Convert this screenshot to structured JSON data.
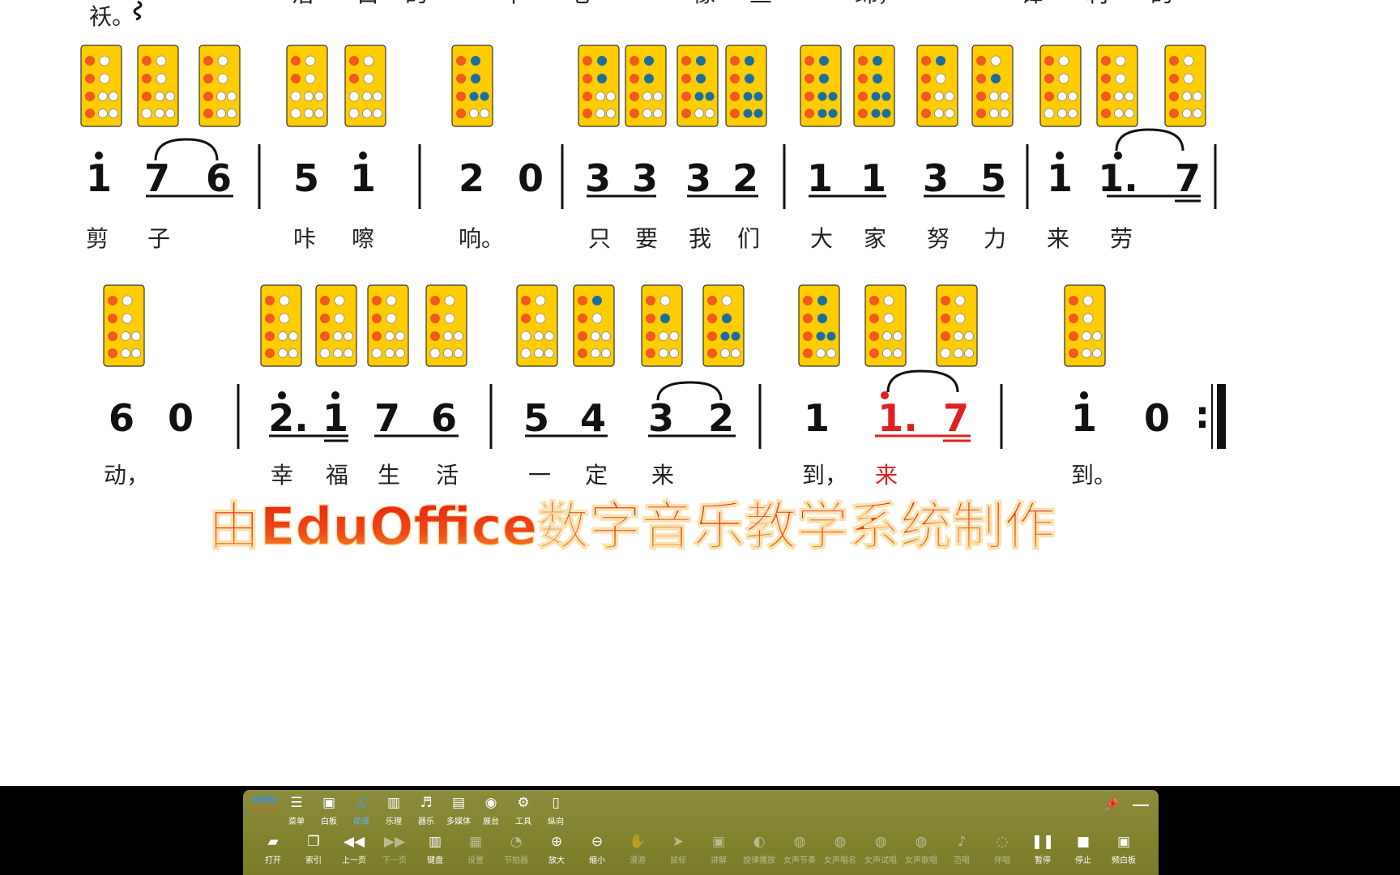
{
  "score": {
    "lyrics": {
      "line0": [
        "袄。",
        "洁",
        "白",
        "的",
        "羊",
        "毛",
        "像",
        "丝",
        "绵，",
        "锋",
        "利",
        "的"
      ],
      "line1": [
        "剪",
        "子",
        "咔",
        "嚓",
        "响。",
        "只",
        "要",
        "我",
        "们",
        "大",
        "家",
        "努",
        "力",
        "来",
        "劳"
      ],
      "line2": [
        "动，",
        "幸",
        "福",
        "生",
        "活",
        "一",
        "定",
        "来",
        "到，",
        "来",
        "到。"
      ]
    },
    "notes": {
      "line1": [
        "1",
        "7",
        "6",
        "5",
        "1",
        "2",
        "0",
        "3",
        "3",
        "3",
        "2",
        "1",
        "1",
        "3",
        "5",
        "1",
        "1.",
        "7"
      ],
      "line2": [
        "6",
        "0",
        "2.",
        "1",
        "7",
        "6",
        "5",
        "4",
        "3",
        "2",
        "1",
        "1.",
        "7",
        "1",
        "0",
        ":"
      ]
    },
    "watermark": "由EduOffice数字音乐教学系统制作",
    "colors": {
      "card_fill": "#ffcc00",
      "hole_open": "#ffffff",
      "hole_covered_orange": "#f05a1e",
      "hole_covered_blue": "#1a6fa0",
      "highlight_red": "#e02020"
    }
  },
  "toolbar": {
    "logo": {
      "text": "edu",
      "subtext": "OFFICE"
    },
    "top": [
      {
        "label": "菜单",
        "icon": "menu-list-icon"
      },
      {
        "label": "白板",
        "icon": "whiteboard-icon"
      },
      {
        "label": "简谱",
        "icon": "notation-icon",
        "active": true
      },
      {
        "label": "乐理",
        "icon": "piano-keys-icon"
      },
      {
        "label": "器乐",
        "icon": "instrument-icon"
      },
      {
        "label": "多媒体",
        "icon": "multimedia-icon"
      },
      {
        "label": "展台",
        "icon": "camera-stand-icon"
      },
      {
        "label": "工具",
        "icon": "gear-icon"
      },
      {
        "label": "纵向",
        "icon": "vertical-layout-icon"
      }
    ],
    "bottom": [
      {
        "label": "打开",
        "icon": "open-folder-icon"
      },
      {
        "label": "索引",
        "icon": "index-icon"
      },
      {
        "label": "上一页",
        "icon": "previous-page-icon"
      },
      {
        "label": "下一页",
        "icon": "next-page-icon",
        "disabled": true
      },
      {
        "label": "键盘",
        "icon": "keyboard-icon"
      },
      {
        "label": "设置",
        "icon": "settings-icon",
        "disabled": true
      },
      {
        "label": "节拍器",
        "icon": "metronome-icon",
        "disabled": true
      },
      {
        "label": "放大",
        "icon": "zoom-in-icon"
      },
      {
        "label": "缩小",
        "icon": "zoom-out-icon"
      },
      {
        "label": "漫游",
        "icon": "hand-pan-icon",
        "disabled": true
      },
      {
        "label": "鼠标",
        "icon": "mouse-cursor-icon",
        "disabled": true
      },
      {
        "label": "讲解",
        "icon": "lecture-icon",
        "disabled": true
      },
      {
        "label": "旋律播放",
        "icon": "melody-play-icon",
        "disabled": true
      },
      {
        "label": "女声节奏",
        "icon": "female-rhythm-icon",
        "disabled": true
      },
      {
        "label": "女声唱名",
        "icon": "female-solfege-icon",
        "disabled": true
      },
      {
        "label": "女声试唱",
        "icon": "female-sing-icon",
        "disabled": true
      },
      {
        "label": "女声歌唱",
        "icon": "female-song-icon",
        "disabled": true
      },
      {
        "label": "范唱",
        "icon": "microphone-icon",
        "disabled": true
      },
      {
        "label": "伴唱",
        "icon": "accompany-icon",
        "disabled": true
      },
      {
        "label": "暂停",
        "icon": "pause-icon"
      },
      {
        "label": "停止",
        "icon": "stop-icon"
      },
      {
        "label": "频白板",
        "icon": "screen-whiteboard-icon"
      }
    ]
  }
}
